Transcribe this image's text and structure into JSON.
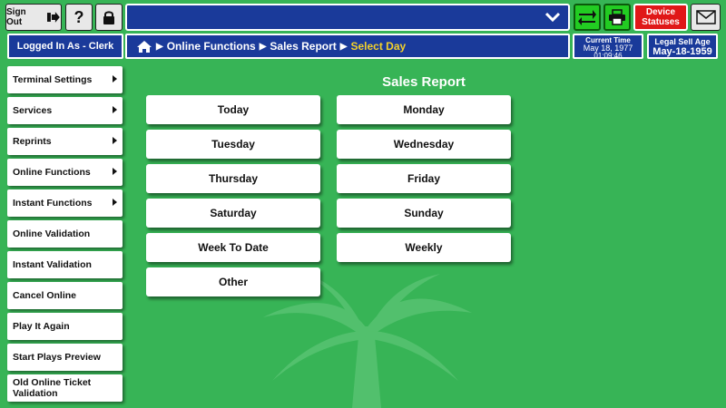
{
  "top_bar": {
    "sign_out_label": "Sign Out",
    "help_label": "?",
    "device_statuses_label": "Device Statuses"
  },
  "header": {
    "logged_in": "Logged In As - Clerk",
    "breadcrumb": [
      "Online Functions",
      "Sales Report",
      "Select Day"
    ],
    "current_time_label": "Current Time",
    "current_date": "May 18, 1977",
    "current_time": "01:09:46",
    "legal_age_label": "Legal Sell Age",
    "legal_age_value": "May-18-1959"
  },
  "sidebar": {
    "items": [
      {
        "label": "Terminal Settings",
        "submenu": true
      },
      {
        "label": "Services",
        "submenu": true
      },
      {
        "label": "Reprints",
        "submenu": true
      },
      {
        "label": "Online Functions",
        "submenu": true
      },
      {
        "label": "Instant Functions",
        "submenu": true
      },
      {
        "label": "Online Validation",
        "submenu": false
      },
      {
        "label": "Instant Validation",
        "submenu": false
      },
      {
        "label": "Cancel Online",
        "submenu": false
      },
      {
        "label": "Play It Again",
        "submenu": false
      },
      {
        "label": "Start Plays Preview",
        "submenu": false
      },
      {
        "label": "Old Online Ticket Validation",
        "submenu": false
      }
    ]
  },
  "main": {
    "title": "Sales Report",
    "left_buttons": [
      "Today",
      "Tuesday",
      "Thursday",
      "Saturday",
      "Week To Date",
      "Other"
    ],
    "right_buttons": [
      "Monday",
      "Wednesday",
      "Friday",
      "Sunday",
      "Weekly"
    ]
  },
  "colors": {
    "background": "#37b456",
    "nav_blue": "#1a3a9a",
    "breadcrumb_current": "#f3d12a",
    "alert_red": "#e01818",
    "action_green": "#22cc22"
  }
}
